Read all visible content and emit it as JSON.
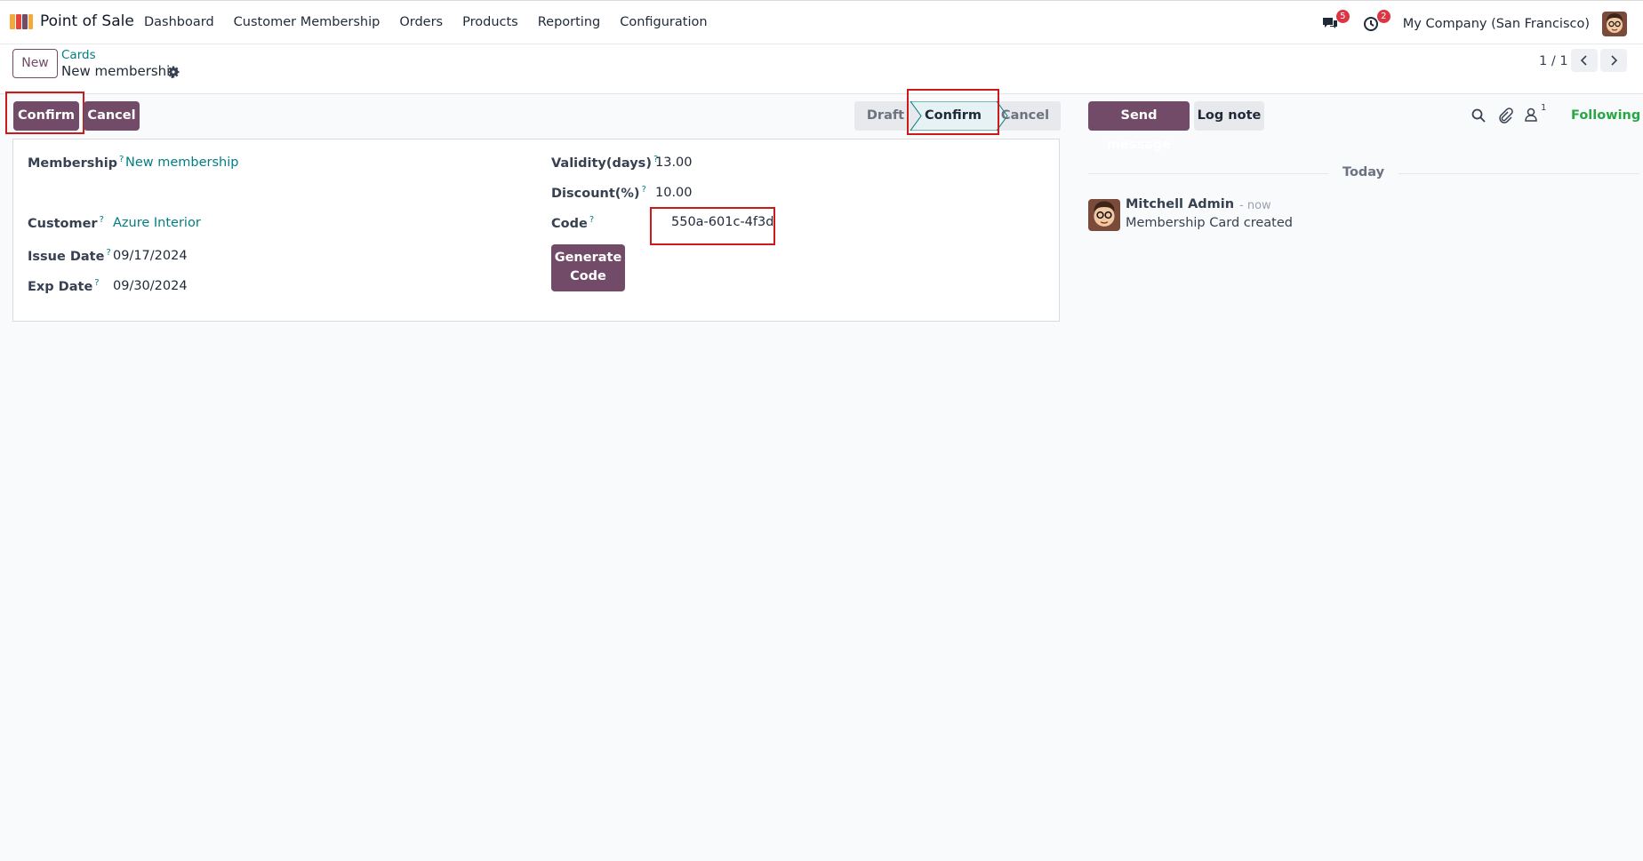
{
  "app": {
    "name": "Point of Sale"
  },
  "nav": {
    "items": [
      {
        "label": "Dashboard"
      },
      {
        "label": "Customer Membership"
      },
      {
        "label": "Orders"
      },
      {
        "label": "Products"
      },
      {
        "label": "Reporting"
      },
      {
        "label": "Configuration"
      }
    ]
  },
  "topright": {
    "messages_count": "5",
    "activities_count": "2",
    "company": "My Company (San Francisco)"
  },
  "control": {
    "new_label": "New",
    "breadcrumb_parent": "Cards",
    "breadcrumb_current": "New membership",
    "pager": "1 / 1"
  },
  "status": {
    "confirm_button": "Confirm",
    "cancel_button": "Cancel",
    "stages": [
      {
        "label": "Draft",
        "active": false
      },
      {
        "label": "Confirm",
        "active": true
      },
      {
        "label": "Cancel",
        "active": false
      }
    ]
  },
  "form": {
    "membership_label": "Membership",
    "membership_value": "New membership",
    "customer_label": "Customer",
    "customer_value": "Azure Interior",
    "issue_date_label": "Issue Date",
    "issue_date_value": "09/17/2024",
    "exp_date_label": "Exp Date",
    "exp_date_value": "09/30/2024",
    "validity_label": "Validity(days)",
    "validity_value": "13.00",
    "discount_label": "Discount(%)",
    "discount_value": "10.00",
    "code_label": "Code",
    "code_value": "550a-601c-4f3d",
    "generate_line1": "Generate",
    "generate_line2": "Code",
    "help_mark": "?"
  },
  "chatter": {
    "send_message": "Send message",
    "log_note": "Log note",
    "followers_count": "1",
    "following": "Following",
    "date_separator": "Today",
    "messages": [
      {
        "author": "Mitchell Admin",
        "time": "- now",
        "body": "Membership Card created"
      }
    ]
  },
  "colors": {
    "brand": "#714b67",
    "link": "#017e84",
    "highlight": "#cc1a1a",
    "following": "#28a745"
  }
}
